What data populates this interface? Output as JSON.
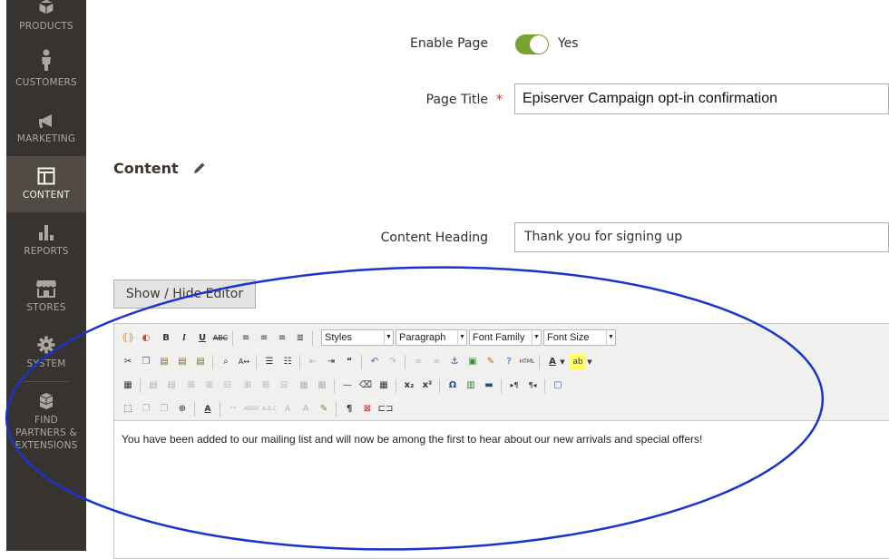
{
  "sidebar": {
    "items": [
      {
        "label": "PRODUCTS",
        "icon": "cube-icon",
        "active": false
      },
      {
        "label": "CUSTOMERS",
        "icon": "person-icon",
        "active": false
      },
      {
        "label": "MARKETING",
        "icon": "megaphone-icon",
        "active": false
      },
      {
        "label": "CONTENT",
        "icon": "layout-icon",
        "active": true
      },
      {
        "label": "REPORTS",
        "icon": "bar-chart-icon",
        "active": false
      },
      {
        "label": "STORES",
        "icon": "storefront-icon",
        "active": false
      },
      {
        "label": "SYSTEM",
        "icon": "gear-icon",
        "active": false
      },
      {
        "label_lines": [
          "FIND",
          "PARTNERS &",
          "EXTENSIONS"
        ],
        "icon": "boxes-icon",
        "active": false
      }
    ]
  },
  "form": {
    "enable_page": {
      "label": "Enable Page",
      "value": "Yes"
    },
    "page_title": {
      "label": "Page Title",
      "required_mark": "*",
      "value": "Episerver Campaign opt-in confirmation"
    },
    "section_title": "Content",
    "content_heading": {
      "label": "Content Heading",
      "value": "Thank you for signing up"
    },
    "show_hide_label": "Show / Hide Editor"
  },
  "editor": {
    "selects": {
      "styles": "Styles",
      "paragraph": "Paragraph",
      "font_family": "Font Family",
      "font_size": "Font Size"
    },
    "body_text": "You have been added to our mailing list and will now be among the first to hear about our new arrivals and special offers!"
  },
  "colors": {
    "sidebar_bg": "#373330",
    "sidebar_active": "#514943",
    "toggle_on": "#79a22e",
    "annotation_oval": "#1a33c8"
  }
}
